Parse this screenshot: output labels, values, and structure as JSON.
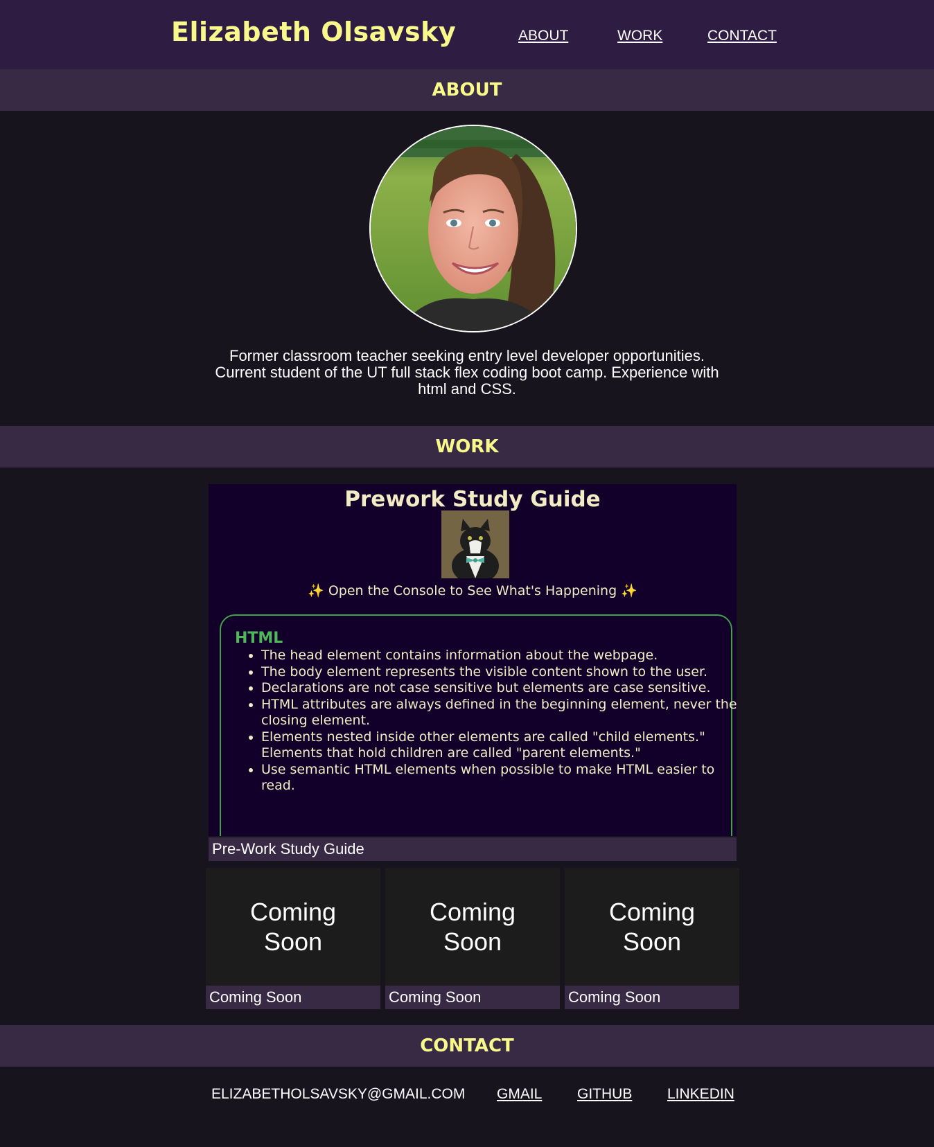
{
  "header": {
    "name": "Elizabeth Olsavsky",
    "nav": [
      "ABOUT",
      "WORK",
      "CONTACT"
    ]
  },
  "about": {
    "heading": "ABOUT",
    "bio": "Former classroom teacher seeking entry level developer opportunities. Current student of the UT full stack flex coding boot camp. Experience with html and CSS."
  },
  "work": {
    "heading": "WORK",
    "featured": {
      "screenshot_title": "Prework Study Guide",
      "screenshot_subtitle": "✨ Open the Console to See What's Happening ✨",
      "screenshot_box_heading": "HTML",
      "screenshot_bullets": [
        "The head element contains information about the webpage.",
        "The body element represents the visible content shown to the user.",
        "Declarations are not case sensitive but elements are case sensitive.",
        "HTML attributes are always defined in the beginning element, never the closing element.",
        "Elements nested inside other elements are called \"child elements.\" Elements that hold children are called \"parent elements.\"",
        "Use semantic HTML elements when possible to make HTML easier to read."
      ],
      "caption": "Pre-Work Study Guide"
    },
    "coming": [
      {
        "image_text": "Coming Soon",
        "caption": "Coming Soon"
      },
      {
        "image_text": "Coming Soon",
        "caption": "Coming Soon"
      },
      {
        "image_text": "Coming Soon",
        "caption": "Coming Soon"
      }
    ]
  },
  "contact": {
    "heading": "CONTACT",
    "email": "ELIZABETHOLSAVSKY@GMAIL.COM",
    "links": [
      "GMAIL",
      "GITHUB",
      "LINKEDIN"
    ]
  },
  "colors": {
    "header_bg": "#2e1c42",
    "section_bar_bg": "#382a45",
    "page_bg": "#17141e",
    "accent_yellow": "#f8f88b"
  }
}
